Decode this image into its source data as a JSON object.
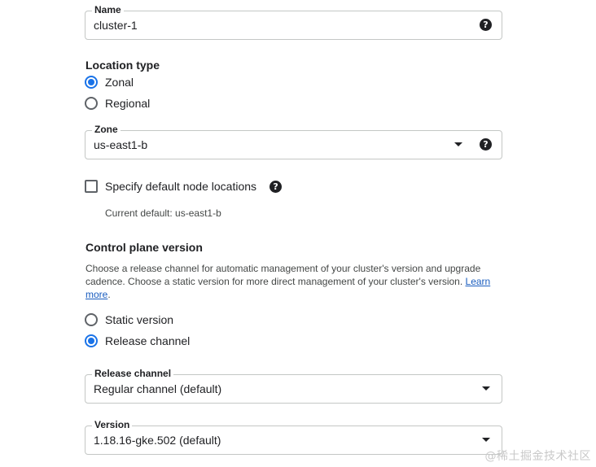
{
  "name_field": {
    "label": "Name",
    "value": "cluster-1",
    "help_icon": "?"
  },
  "location_type": {
    "title": "Location type",
    "options": [
      {
        "label": "Zonal",
        "checked": true
      },
      {
        "label": "Regional",
        "checked": false
      }
    ]
  },
  "zone_field": {
    "label": "Zone",
    "value": "us-east1-b",
    "help_icon": "?"
  },
  "node_locations": {
    "label": "Specify default node locations",
    "checked": false,
    "help_icon": "?",
    "current_default": "Current default: us-east1-b"
  },
  "control_plane": {
    "title": "Control plane version",
    "description": "Choose a release channel for automatic management of your cluster's version and upgrade cadence. Choose a static version for more direct management of your cluster's version. ",
    "learn_more": "Learn more",
    "description_end": ".",
    "options": [
      {
        "label": "Static version",
        "checked": false
      },
      {
        "label": "Release channel",
        "checked": true
      }
    ]
  },
  "release_channel_field": {
    "label": "Release channel",
    "value": "Regular channel (default)"
  },
  "version_field": {
    "label": "Version",
    "value": "1.18.16-gke.502 (default)"
  },
  "watermark": "@稀土掘金技术社区",
  "colors": {
    "accent": "#1a73e8",
    "link": "#1a5dbf",
    "border": "#c4c7c5",
    "text": "#202124"
  }
}
